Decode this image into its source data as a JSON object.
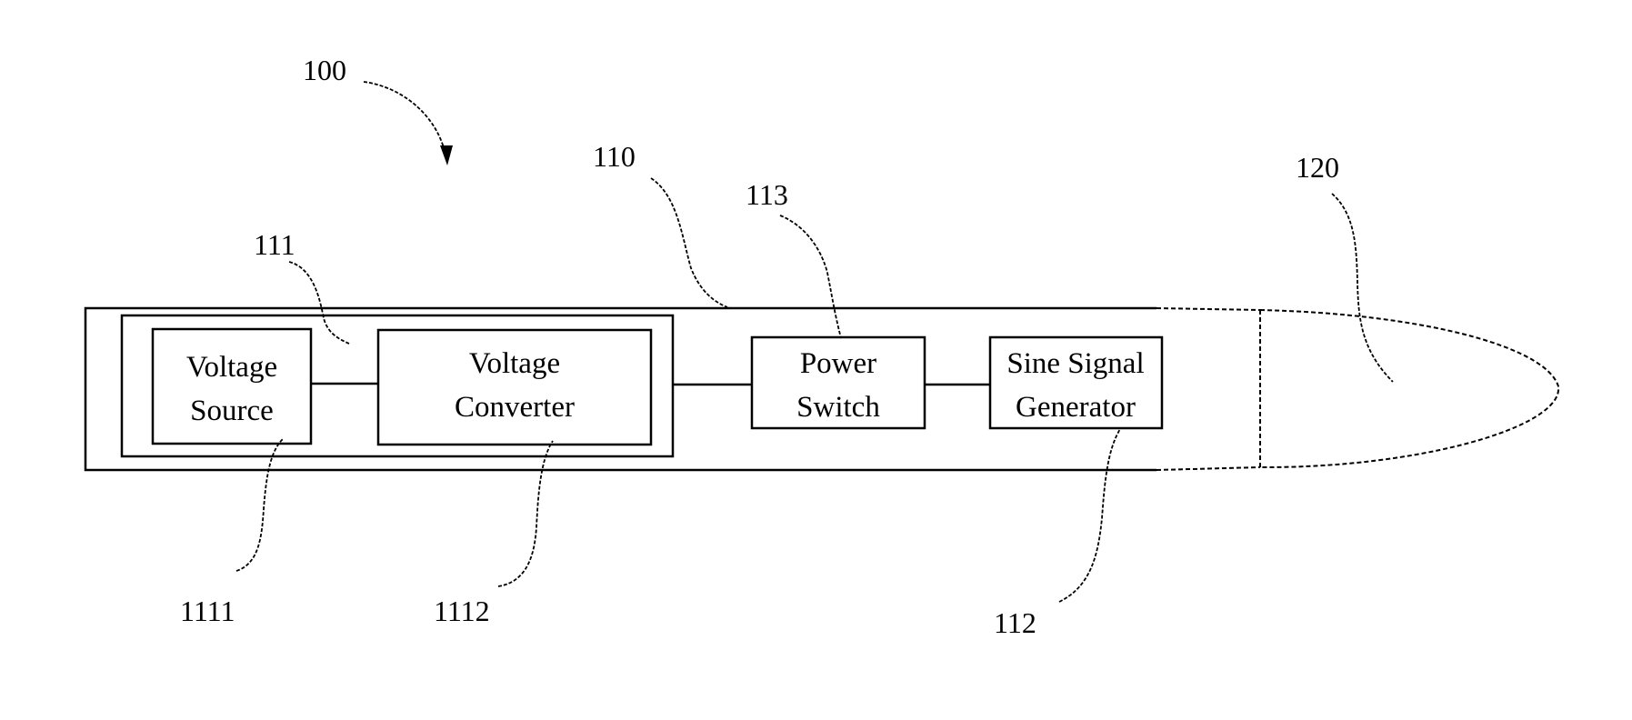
{
  "figure": {
    "reference_labels": {
      "device": "100",
      "body": "110",
      "power_module": "111",
      "voltage_source": "1111",
      "voltage_converter": "1112",
      "sine_signal_generator": "112",
      "power_switch": "113",
      "tip": "120"
    },
    "blocks": {
      "voltage_source": [
        "Voltage",
        "Source"
      ],
      "voltage_converter": [
        "Voltage",
        "Converter"
      ],
      "power_switch": [
        "Power",
        "Switch"
      ],
      "sine_signal_generator": [
        "Sine Signal",
        "Generator"
      ]
    }
  }
}
